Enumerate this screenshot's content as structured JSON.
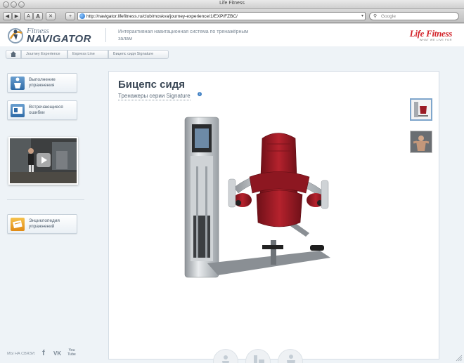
{
  "window": {
    "title": "Life Fitness"
  },
  "browser": {
    "back_icon": "back-arrow-icon",
    "forward_icon": "forward-arrow-icon",
    "text_small_label": "A",
    "text_large_label": "A",
    "stop_label": "✕",
    "add_label": "+",
    "url": "http://navigator.lifefitness.ru/club/moskva/journey-experience/1/EXP/FZBC/",
    "search_placeholder": "Google"
  },
  "header": {
    "brand_line1": "Fitness",
    "brand_line2": "NAVIGATOR",
    "tagline": "Интерактивная навигационная система по тренажёрным залам",
    "partner_logo": "Life Fitness",
    "partner_tagline": "WHAT WE LIVE FOR"
  },
  "breadcrumb": {
    "items": [
      "Journey Experience",
      "Express Line",
      "Бицепс сидя Signature"
    ]
  },
  "sidebar": {
    "buttons": [
      {
        "label": "Выполнение упражнения",
        "icon": "exercise-icon"
      },
      {
        "label": "Встречающиеся ошибки",
        "icon": "mistakes-icon"
      },
      {
        "label": "Энциклопедия упражнений",
        "icon": "encyclopedia-icon"
      }
    ],
    "video_icon": "play-icon",
    "social_label": "МЫ НА СВЯЗИ:",
    "social": [
      "f",
      "VK",
      "You Tube"
    ]
  },
  "product": {
    "title": "Бицепс сидя",
    "subtitle": "Тренажеры серии Signature",
    "info_icon": "info-icon"
  },
  "colors": {
    "brand_red": "#d2232a",
    "seat_red": "#9b1b24",
    "accent_blue": "#3e7fc3"
  }
}
